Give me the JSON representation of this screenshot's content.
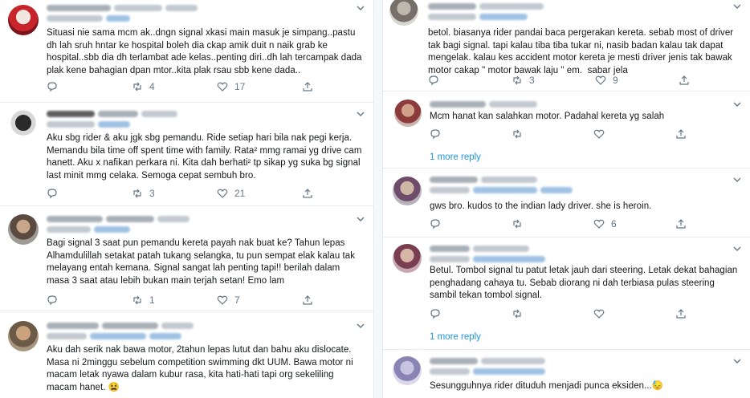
{
  "left_tweets": [
    {
      "text": "Situasi nie sama mcm ak..dngn signal xkasi main masuk je simpang..pastu dh lah sruh hntar ke hospital boleh dia ckap amik duit n naik grab ke hospital..sbb dia dh terlambat ade kelas..penting diri..dh lah tercampak dada plak kene bahagian dpan mtor..kita plak rsau sbb kene dada..",
      "retweets": "4",
      "likes": "17"
    },
    {
      "text": "Aku sbg rider & aku jgk sbg pemandu. Ride setiap hari bila nak pegi kerja. Memandu bila time off spent time with family. Rata² mmg ramai yg drive cam hanett. Aku x nafikan perkara ni. Kita dah berhati² tp sikap yg suka bg signal last minit mmg celaka. Semoga cepat sembuh bro.",
      "retweets": "3",
      "likes": "21"
    },
    {
      "text": "Bagi signal 3 saat pun pemandu kereta payah nak buat ke? Tahun lepas Alhamdulillah setakat patah tukang selangka, tu pun sempat elak kalau tak melayang entah kemana. Signal sangat lah penting tapi!! berilah dalam masa 3 saat atau lebih bukan main terjah setan! Emo lam",
      "retweets": "1",
      "likes": "7"
    },
    {
      "text": "Aku dah serik nak bawa motor, 2tahun lepas lutut dan bahu aku dislocate. Masa ni 2minggu sebelum competition swimming dkt UUM. Bawa motor ni macam letak nyawa dalam kubur rasa, kita hati-hati tapi org sekeliling macam hanet. 😫"
    }
  ],
  "right_tweets": [
    {
      "text": "betol. biasanya rider pandai baca pergerakan kereta. sebab most of driver tak bagi signal. tapi kalau tiba tiba tukar ni, nasib badan kalau tak dapat mengelak. kalau kes accident motor kereta je mesti driver jenis tak bawak motor cakap \" motor bawak laju \" em.  sabar jela",
      "retweets": "3",
      "likes": "9"
    },
    {
      "text": "Mcm hanat kan salahkan motor. Padahal kereta yg salah",
      "more_reply": "1 more reply"
    },
    {
      "text": "gws bro. kudos to the indian lady driver. she is heroin.",
      "likes": "6"
    },
    {
      "text": "Betul. Tombol signal tu patut letak jauh dari steering. Letak dekat bahagian penghadang cahaya tu. Sebab diorang ni dah terbiasa pulas steering sambil tekan tombol signal.",
      "more_reply": "1 more reply"
    },
    {
      "text": "Sesungguhnya rider dituduh menjadi punca eksiden...😓"
    }
  ],
  "colors": {
    "link": "#1b95e0",
    "muted": "#657786",
    "border": "#e6ecf0",
    "text": "#14171a"
  },
  "icons": [
    "reply-icon",
    "retweet-icon",
    "like-icon",
    "share-icon",
    "chevron-down-icon"
  ]
}
